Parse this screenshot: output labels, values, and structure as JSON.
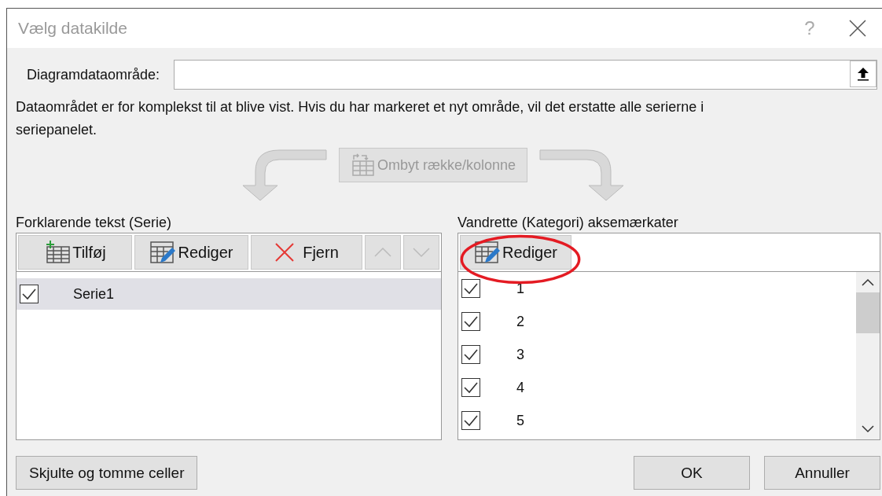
{
  "window": {
    "title": "Vælg datakilde",
    "help": "?"
  },
  "range_field": {
    "label": "Diagramdataområde:"
  },
  "message": "Dataområdet er for komplekst til at blive vist. Hvis du har markeret et nyt område, vil det erstatte alle serierne i seriepanelet.",
  "swap_button": {
    "label": "Ombyt række/kolonne",
    "disabled": true
  },
  "series_panel": {
    "title": "Forklarende tekst (Serie)",
    "toolbar": [
      {
        "kind": "add",
        "label": "Tilføj",
        "disabled": false
      },
      {
        "kind": "edit",
        "label": "Rediger",
        "disabled": false
      },
      {
        "kind": "remove",
        "label": "Fjern",
        "disabled": false
      },
      {
        "kind": "up",
        "disabled": true
      },
      {
        "kind": "down",
        "disabled": true
      }
    ],
    "items": [
      {
        "label": "Serie1",
        "checked": true,
        "selected": true
      }
    ]
  },
  "category_panel": {
    "title": "Vandrette (Kategori) aksemærkater",
    "edit_button": {
      "label": "Rediger"
    },
    "items": [
      {
        "label": "1",
        "checked": true
      },
      {
        "label": "2",
        "checked": true
      },
      {
        "label": "3",
        "checked": true
      },
      {
        "label": "4",
        "checked": true
      },
      {
        "label": "5",
        "checked": true
      }
    ]
  },
  "hidden_cells_button": {
    "label": "Skjulte og tomme celler"
  },
  "buttons": [
    {
      "label": "OK"
    },
    {
      "label": "Annuller"
    }
  ]
}
